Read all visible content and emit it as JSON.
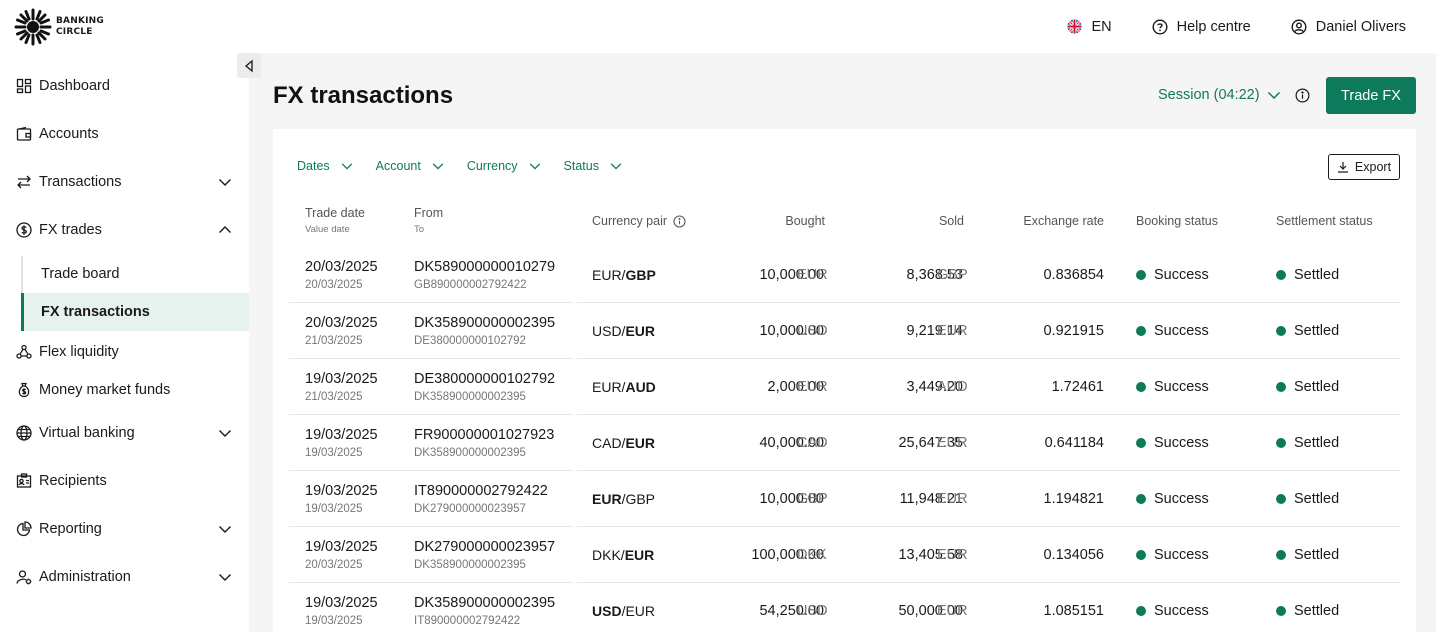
{
  "brand": {
    "line1": "BANKING",
    "line2": "CIRCLE"
  },
  "topbar": {
    "language": "EN",
    "help": "Help centre",
    "user": "Daniel Olivers"
  },
  "sidebar": {
    "items": [
      {
        "label": "Dashboard",
        "icon": "dashboard-icon"
      },
      {
        "label": "Accounts",
        "icon": "wallet-icon"
      },
      {
        "label": "Transactions",
        "icon": "arrows-icon"
      },
      {
        "label": "FX trades",
        "icon": "dollar-icon"
      },
      {
        "label": "Flex liquidity",
        "icon": "network-icon"
      },
      {
        "label": "Money market funds",
        "icon": "money-bag-icon"
      },
      {
        "label": "Virtual banking",
        "icon": "globe-icon"
      },
      {
        "label": "Recipients",
        "icon": "contacts-icon"
      },
      {
        "label": "Reporting",
        "icon": "pie-chart-icon"
      },
      {
        "label": "Administration",
        "icon": "user-gear-icon"
      }
    ],
    "fx_sub": [
      {
        "label": "Trade board"
      },
      {
        "label": "FX transactions"
      }
    ]
  },
  "page": {
    "title": "FX transactions",
    "session": "Session (04:22)",
    "trade_button": "Trade FX"
  },
  "filters": {
    "dates": "Dates",
    "account": "Account",
    "currency": "Currency",
    "status": "Status",
    "export": "Export"
  },
  "columns": {
    "trade_date": "Trade date",
    "value_date": "Value date",
    "from": "From",
    "to": "To",
    "pair": "Currency pair",
    "bought": "Bought",
    "sold": "Sold",
    "rate": "Exchange rate",
    "booking": "Booking status",
    "settlement": "Settlement status"
  },
  "colors": {
    "accent": "#0e7a5c",
    "success": "#0e7a5c"
  },
  "rows": [
    {
      "trade_date": "20/03/2025",
      "value_date": "20/03/2025",
      "from": "DK589000000010279",
      "to": "GB890000002792422",
      "pair_a": "EUR/",
      "pair_b": "GBP",
      "bold": "b",
      "bought": "10,000.00",
      "bought_cur": "EUR",
      "sold": "8,368.53",
      "sold_cur": "GBP",
      "rate": "0.836854",
      "booking": "Success",
      "settlement": "Settled"
    },
    {
      "trade_date": "20/03/2025",
      "value_date": "21/03/2025",
      "from": "DK358900000002395",
      "to": "DE380000000102792",
      "pair_a": "USD/",
      "pair_b": "EUR",
      "bold": "b",
      "bought": "10,000.00",
      "bought_cur": "USD",
      "sold": "9,219.14",
      "sold_cur": "EUR",
      "rate": "0.921915",
      "booking": "Success",
      "settlement": "Settled"
    },
    {
      "trade_date": "19/03/2025",
      "value_date": "21/03/2025",
      "from": "DE380000000102792",
      "to": "DK358900000002395",
      "pair_a": "EUR/",
      "pair_b": "AUD",
      "bold": "b",
      "bought": "2,000.00",
      "bought_cur": "EUR",
      "sold": "3,449.20",
      "sold_cur": "AUD",
      "rate": "1.72461",
      "booking": "Success",
      "settlement": "Settled"
    },
    {
      "trade_date": "19/03/2025",
      "value_date": "19/03/2025",
      "from": "FR900000001027923",
      "to": "DK358900000002395",
      "pair_a": "CAD/",
      "pair_b": "EUR",
      "bold": "b",
      "bought": "40,000.00",
      "bought_cur": "CAD",
      "sold": "25,647.35",
      "sold_cur": "EUR",
      "rate": "0.641184",
      "booking": "Success",
      "settlement": "Settled"
    },
    {
      "trade_date": "19/03/2025",
      "value_date": "19/03/2025",
      "from": "IT890000002792422",
      "to": "DK279000000023957",
      "pair_a": "EUR",
      "pair_b": "/GBP",
      "bold": "a",
      "bought": "10,000.00",
      "bought_cur": "GBP",
      "sold": "11,948.21",
      "sold_cur": "EUR",
      "rate": "1.194821",
      "booking": "Success",
      "settlement": "Settled"
    },
    {
      "trade_date": "19/03/2025",
      "value_date": "20/03/2025",
      "from": "DK279000000023957",
      "to": "DK358900000002395",
      "pair_a": "DKK/",
      "pair_b": "EUR",
      "bold": "b",
      "bought": "100,000.00",
      "bought_cur": "DKK",
      "sold": "13,405.58",
      "sold_cur": "EUR",
      "rate": "0.134056",
      "booking": "Success",
      "settlement": "Settled"
    },
    {
      "trade_date": "19/03/2025",
      "value_date": "19/03/2025",
      "from": "DK358900000002395",
      "to": "IT890000002792422",
      "pair_a": "USD",
      "pair_b": "/EUR",
      "bold": "a",
      "bought": "54,250.00",
      "bought_cur": "USD",
      "sold": "50,000.00",
      "sold_cur": "EUR",
      "rate": "1.085151",
      "booking": "Success",
      "settlement": "Settled"
    }
  ]
}
